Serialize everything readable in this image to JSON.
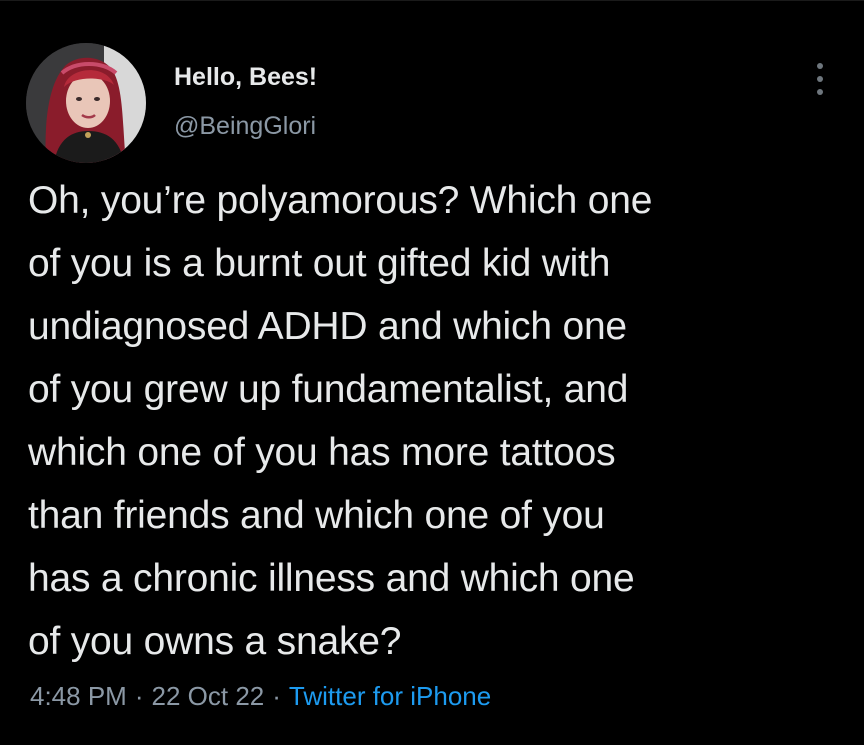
{
  "user": {
    "display_name": "Hello, Bees!",
    "handle": "@BeingGlori",
    "avatar_icon": "profile-photo-avatar"
  },
  "menu": {
    "icon": "more-options-icon"
  },
  "tweet": {
    "lines": [
      "Oh, you’re polyamorous? Which one",
      "of you is a burnt out gifted kid with",
      "undiagnosed ADHD and which one",
      "of you grew up fundamentalist, and",
      "which one of you has more tattoos",
      "than friends and which one of you",
      "has a chronic illness and which one",
      "of you owns a snake?"
    ]
  },
  "meta": {
    "time": "4:48 PM",
    "separator": "·",
    "date": "22 Oct 22",
    "source": "Twitter for iPhone"
  },
  "colors": {
    "background": "#000000",
    "text": "#e7e9ea",
    "secondary": "#8b98a5",
    "link": "#1d9bf0"
  }
}
